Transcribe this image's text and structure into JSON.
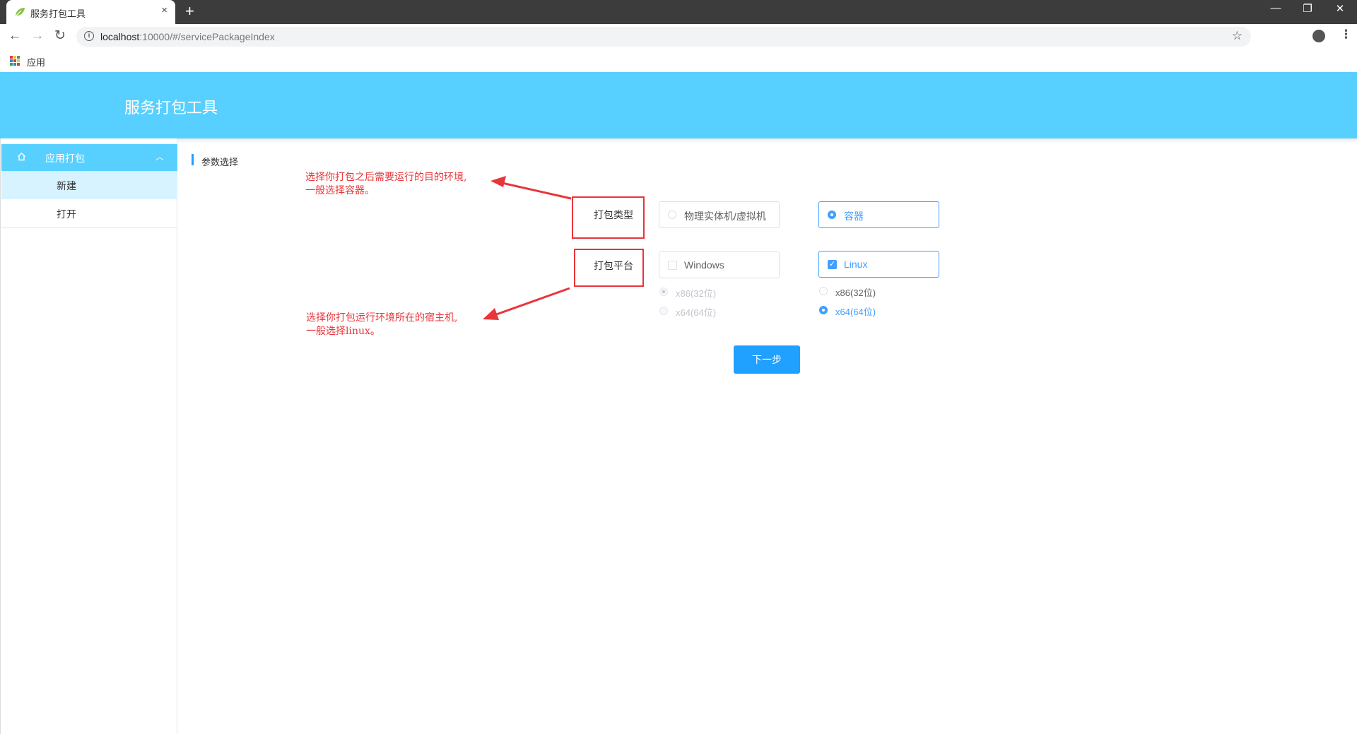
{
  "browser": {
    "tab_title": "服务打包工具",
    "tab_close": "×",
    "new_tab": "+",
    "url_host": "localhost",
    "url_rest": ":10000/#/servicePackageIndex",
    "bookmark_label": "应用",
    "window_controls": [
      "—",
      "❐",
      "✕"
    ]
  },
  "app": {
    "title": "服务打包工具"
  },
  "sidebar": {
    "group_label": "应用打包",
    "group_icon": "home-icon",
    "items": [
      {
        "label": "新建",
        "active": true
      },
      {
        "label": "打开",
        "active": false
      }
    ]
  },
  "content": {
    "section_title": "参数选择",
    "package_type": {
      "label": "打包类型",
      "options": [
        {
          "label": "物理实体机/虚拟机",
          "selected": false
        },
        {
          "label": "容器",
          "selected": true
        }
      ]
    },
    "package_platform": {
      "label": "打包平台",
      "options": [
        {
          "label": "Windows",
          "checked": false,
          "arch": [
            {
              "label": "x86(32位)",
              "selected": true,
              "disabled": true
            },
            {
              "label": "x64(64位)",
              "selected": false,
              "disabled": true
            }
          ]
        },
        {
          "label": "Linux",
          "checked": true,
          "arch": [
            {
              "label": "x86(32位)",
              "selected": false,
              "disabled": false
            },
            {
              "label": "x64(64位)",
              "selected": true,
              "disabled": false
            }
          ]
        }
      ]
    },
    "next_button": "下一步"
  },
  "annotations": {
    "type_note_line1": "选择你打包之后需要运行的目的环境,",
    "type_note_line2": "一般选择容器。",
    "platform_note_line1": "选择你打包运行环境所在的宿主机,",
    "platform_note_line2": "一般选择linux。"
  },
  "colors": {
    "header_bg": "#57d0ff",
    "primary": "#409eff",
    "button_bg": "#20a0ff",
    "annotation_red": "#e8353a",
    "active_menu_bg": "#d7f3ff"
  }
}
